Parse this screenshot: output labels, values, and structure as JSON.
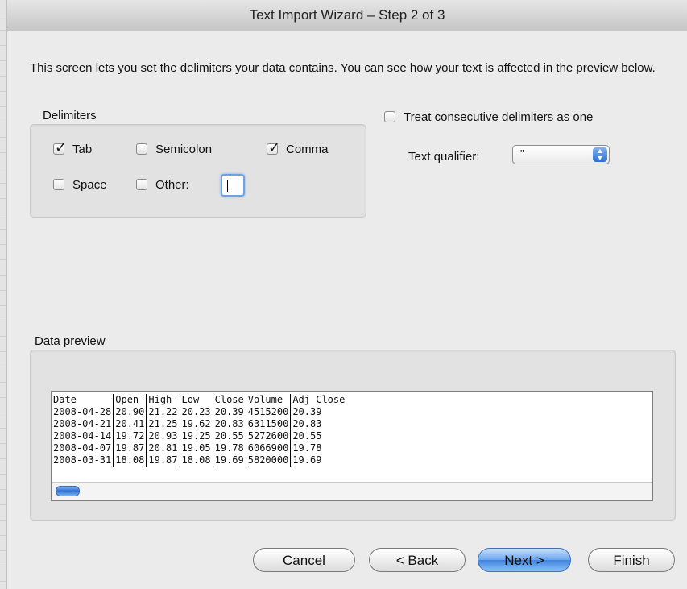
{
  "window": {
    "title": "Text Import Wizard – Step 2 of 3"
  },
  "intro_text": "This screen lets you set the delimiters your data contains.  You can see how your text is affected in the preview below.",
  "delimiters": {
    "label": "Delimiters",
    "tab": {
      "label": "Tab",
      "checked": true
    },
    "semicolon": {
      "label": "Semicolon",
      "checked": false
    },
    "comma": {
      "label": "Comma",
      "checked": true
    },
    "space": {
      "label": "Space",
      "checked": false
    },
    "other": {
      "label": "Other:",
      "checked": false,
      "value": ""
    }
  },
  "treat_consecutive": {
    "label": "Treat consecutive delimiters as one",
    "checked": false
  },
  "text_qualifier": {
    "label": "Text qualifier:",
    "value": "\""
  },
  "preview": {
    "label": "Data preview",
    "headers": [
      "Date",
      "Open",
      "High",
      "Low",
      "Close",
      "Volume",
      "Adj Close"
    ],
    "rows": [
      [
        "2008-04-28",
        "20.90",
        "21.22",
        "20.23",
        "20.39",
        "4515200",
        "20.39"
      ],
      [
        "2008-04-21",
        "20.41",
        "21.25",
        "19.62",
        "20.83",
        "6311500",
        "20.83"
      ],
      [
        "2008-04-14",
        "19.72",
        "20.93",
        "19.25",
        "20.55",
        "5272600",
        "20.55"
      ],
      [
        "2008-04-07",
        "19.87",
        "20.81",
        "19.05",
        "19.78",
        "6066900",
        "19.78"
      ],
      [
        "2008-03-31",
        "18.08",
        "19.87",
        "18.08",
        "19.69",
        "5820000",
        "19.69"
      ]
    ]
  },
  "buttons": {
    "cancel": "Cancel",
    "back": "< Back",
    "next": "Next >",
    "finish": "Finish"
  },
  "colors": {
    "accent": "#3d83e0",
    "focus_ring": "#6fa2de"
  }
}
